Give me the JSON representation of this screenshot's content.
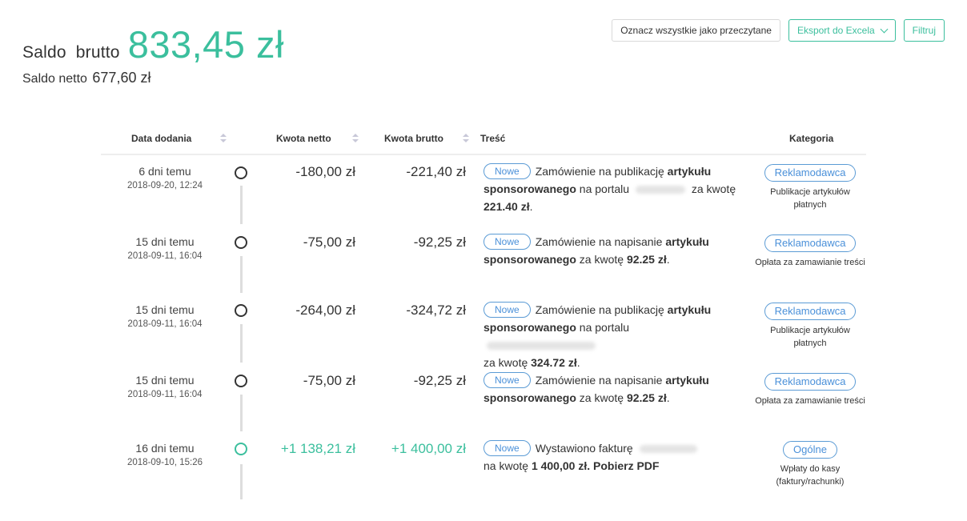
{
  "balance": {
    "gross_label": "Saldo  brutto",
    "gross_value": "833,45 zł",
    "net_label": "Saldo netto",
    "net_value": "677,60 zł"
  },
  "toolbar": {
    "mark_all_read": "Oznacz wszystkie jako przeczytane",
    "export_excel": "Eksport do Excela",
    "filter": "Filtruj"
  },
  "table": {
    "headers": {
      "date": "Data dodania",
      "net": "Kwota netto",
      "gross": "Kwota brutto",
      "content": "Treść",
      "category": "Kategoria"
    },
    "rows": [
      {
        "relative": "6 dni temu",
        "date": "2018-09-20, 12:24",
        "net": "-180,00 zł",
        "gross": "-221,40 zł",
        "badge": "Nowe",
        "t1": "Zamówienie na publikację ",
        "b1": "artykułu sponsorowanego",
        "t2": " na portalu ",
        "t3": " za kwotę ",
        "b2": "221.40 zł",
        "t4": ".",
        "category": "Reklamodawca",
        "category_desc": "Publikacje artykułów płatnych"
      },
      {
        "relative": "15 dni temu",
        "date": "2018-09-11, 16:04",
        "net": "-75,00 zł",
        "gross": "-92,25 zł",
        "badge": "Nowe",
        "t1": "Zamówienie na napisanie ",
        "b1": "artykułu sponsorowanego",
        "t2": " za kwotę ",
        "b2": "92.25 zł",
        "t3": ".",
        "category": "Reklamodawca",
        "category_desc": "Opłata za zamawianie treści"
      },
      {
        "relative": "15 dni temu",
        "date": "2018-09-11, 16:04",
        "net": "-264,00 zł",
        "gross": "-324,72 zł",
        "badge": "Nowe",
        "t1": "Zamówienie na publikację ",
        "b1": "artykułu sponsorowanego",
        "t2": " na portalu ",
        "t3": " za kwotę ",
        "b2": "324.72 zł",
        "t4": ".",
        "category": "Reklamodawca",
        "category_desc": "Publikacje artykułów płatnych"
      },
      {
        "relative": "15 dni temu",
        "date": "2018-09-11, 16:04",
        "net": "-75,00 zł",
        "gross": "-92,25 zł",
        "badge": "Nowe",
        "t1": "Zamówienie na napisanie ",
        "b1": "artykułu sponsorowanego",
        "t2": " za kwotę ",
        "b2": "92.25 zł",
        "t3": ".",
        "category": "Reklamodawca",
        "category_desc": "Opłata za zamawianie treści"
      },
      {
        "relative": "16 dni temu",
        "date": "2018-09-10, 15:26",
        "net": "+1 138,21 zł",
        "gross": "+1 400,00 zł",
        "badge": "Nowe",
        "t1": "Wystawiono fakturę ",
        "t2": "na kwotę ",
        "b1": "1 400,00 zł",
        "t3": ". ",
        "b2": "Pobierz PDF",
        "category": "Ogólne",
        "category_desc": "Wpłaty do kasy (faktury/rachunki)"
      }
    ]
  },
  "colors": {
    "accent": "#3bbf9d",
    "badge_blue": "#4a90d9",
    "text": "#333333"
  }
}
